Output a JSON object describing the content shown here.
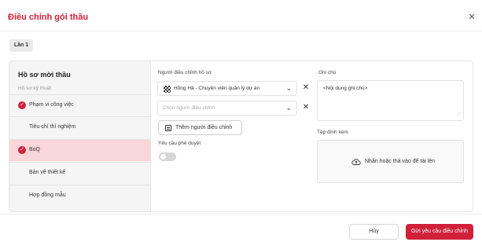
{
  "dialog": {
    "title": "Điều chỉnh gói thầu",
    "close_icon": "close-icon",
    "accent_color": "#d0203a"
  },
  "round": {
    "label": "Lần 1"
  },
  "sidebar": {
    "title": "Hồ sơ mời thầu",
    "subtitle": "Hồ sơ kỹ thuật",
    "items": [
      {
        "label": "Phạm vi công việc",
        "checked": true,
        "active": false
      },
      {
        "label": "Tiêu chí thí nghiệm",
        "checked": false,
        "active": false
      },
      {
        "label": "BoQ",
        "checked": true,
        "active": true
      },
      {
        "label": "Bản vẽ thiết kế",
        "checked": false,
        "active": false
      },
      {
        "label": "Hợp đồng mẫu",
        "checked": false,
        "active": false
      }
    ]
  },
  "adjusters": {
    "label": "Người điều chỉnh hồ sơ",
    "selected": "Hồng Hà - Chuyên viên quản lý dự án",
    "placeholder": "Chọn người điều chỉnh",
    "add_button": "Thêm người điều chỉnh"
  },
  "approval": {
    "label": "Yêu cầu phê duyệt",
    "enabled": false
  },
  "note": {
    "label": "Ghi chú",
    "value": "<Nội dung ghi chú>"
  },
  "attachments": {
    "label": "Tệp đính kèm",
    "drop_text": "Nhấn hoặc thả vào để tải lên",
    "icon": "cloud-upload-icon"
  },
  "footer": {
    "cancel": "Hủy",
    "submit": "Gửi yêu cầu điều chỉnh"
  }
}
